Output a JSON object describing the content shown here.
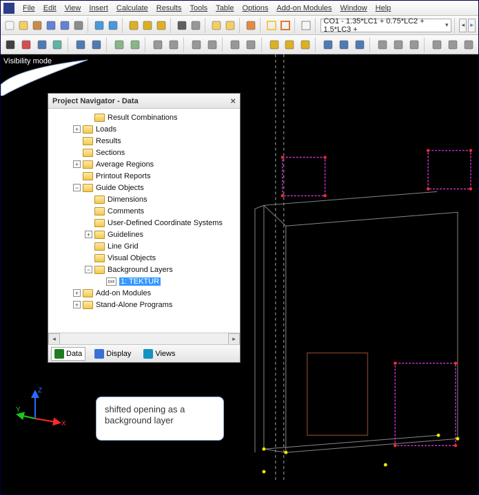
{
  "menu": {
    "items": [
      "File",
      "Edit",
      "View",
      "Insert",
      "Calculate",
      "Results",
      "Tools",
      "Table",
      "Options",
      "Add-on Modules",
      "Window",
      "Help"
    ]
  },
  "combo": {
    "value": "CO1 - 1.35*LC1 + 0.75*LC2 + 1.5*LC3 +"
  },
  "visibility_label": "Visibility mode",
  "panel": {
    "title": "Project Navigator - Data",
    "rows": [
      {
        "indent": 3,
        "exp": null,
        "icon": "fld",
        "label": "Result Combinations"
      },
      {
        "indent": 2,
        "exp": "+",
        "icon": "fld",
        "label": "Loads"
      },
      {
        "indent": 2,
        "exp": null,
        "icon": "fld",
        "label": "Results"
      },
      {
        "indent": 2,
        "exp": null,
        "icon": "fld",
        "label": "Sections"
      },
      {
        "indent": 2,
        "exp": "+",
        "icon": "fld",
        "label": "Average Regions"
      },
      {
        "indent": 2,
        "exp": null,
        "icon": "fld",
        "label": "Printout Reports"
      },
      {
        "indent": 2,
        "exp": "-",
        "icon": "fld",
        "label": "Guide Objects"
      },
      {
        "indent": 3,
        "exp": null,
        "icon": "fld",
        "label": "Dimensions"
      },
      {
        "indent": 3,
        "exp": null,
        "icon": "fld",
        "label": "Comments"
      },
      {
        "indent": 3,
        "exp": null,
        "icon": "fld",
        "label": "User-Defined Coordinate Systems"
      },
      {
        "indent": 3,
        "exp": "+",
        "icon": "fld",
        "label": "Guidelines"
      },
      {
        "indent": 3,
        "exp": null,
        "icon": "fld",
        "label": "Line Grid"
      },
      {
        "indent": 3,
        "exp": null,
        "icon": "fld",
        "label": "Visual Objects"
      },
      {
        "indent": 3,
        "exp": "-",
        "icon": "fld",
        "label": "Background Layers"
      },
      {
        "indent": 4,
        "exp": null,
        "icon": "dxf",
        "label": "1: TEKTUR",
        "selected": true
      },
      {
        "indent": 2,
        "exp": "+",
        "icon": "fld",
        "label": "Add-on Modules"
      },
      {
        "indent": 2,
        "exp": "+",
        "icon": "fld",
        "label": "Stand-Alone Programs"
      }
    ],
    "tabs": [
      {
        "label": "Data",
        "active": true,
        "icon": "#1e7e1e"
      },
      {
        "label": "Display",
        "active": false,
        "icon": "#3a6fd8"
      },
      {
        "label": "Views",
        "active": false,
        "icon": "#1393c2"
      }
    ]
  },
  "callout_text": "shifted opening as a background layer",
  "gizmo": {
    "x": "X",
    "y": "Y",
    "z": "Z"
  },
  "toolbar_icons_row1": [
    {
      "n": "new-icon",
      "c": "#f5f5f5"
    },
    {
      "n": "open-icon",
      "c": "#f3c84e"
    },
    {
      "n": "model-icon",
      "c": "#c07a2a"
    },
    {
      "n": "save-icon",
      "c": "#4a6fd0"
    },
    {
      "n": "save-all-icon",
      "c": "#4a6fd0"
    },
    {
      "n": "print-icon",
      "c": "#7a7a7a"
    },
    {
      "n": "sep"
    },
    {
      "n": "undo-icon",
      "c": "#2b88d8"
    },
    {
      "n": "redo-icon",
      "c": "#2b88d8"
    },
    {
      "n": "sep"
    },
    {
      "n": "calculate-icon",
      "c": "#d9a400"
    },
    {
      "n": "highlight-icon",
      "c": "#d9a400"
    },
    {
      "n": "dimension-icon",
      "c": "#d9a400"
    },
    {
      "n": "sep"
    },
    {
      "n": "snap-icon",
      "c": "#444"
    },
    {
      "n": "grid-icon",
      "c": "#888"
    },
    {
      "n": "sep"
    },
    {
      "n": "doc-a-icon",
      "c": "#f3c84e"
    },
    {
      "n": "doc-b-icon",
      "c": "#f3c84e"
    },
    {
      "n": "sep"
    },
    {
      "n": "results-icon",
      "c": "#e07828"
    },
    {
      "n": "sep"
    }
  ],
  "toolbar_icons_row2": [
    {
      "n": "cursor-icon",
      "c": "#222"
    },
    {
      "n": "node-icon",
      "c": "#c33"
    },
    {
      "n": "member-icon",
      "c": "#36a"
    },
    {
      "n": "surface-icon",
      "c": "#4a9"
    },
    {
      "n": "sep"
    },
    {
      "n": "load-node-icon",
      "c": "#36a"
    },
    {
      "n": "load-line-icon",
      "c": "#36a"
    },
    {
      "n": "sep"
    },
    {
      "n": "support-a-icon",
      "c": "#7a7"
    },
    {
      "n": "support-b-icon",
      "c": "#7a7"
    },
    {
      "n": "sep"
    },
    {
      "n": "copy-icon",
      "c": "#888"
    },
    {
      "n": "mirror-icon",
      "c": "#888"
    },
    {
      "n": "sep"
    },
    {
      "n": "rotate-icon",
      "c": "#888"
    },
    {
      "n": "scale-icon",
      "c": "#888"
    },
    {
      "n": "sep"
    },
    {
      "n": "mesh-icon",
      "c": "#888"
    },
    {
      "n": "refine-icon",
      "c": "#888"
    },
    {
      "n": "sep"
    },
    {
      "n": "filter-a-icon",
      "c": "#d9a400"
    },
    {
      "n": "filter-b-icon",
      "c": "#d9a400"
    },
    {
      "n": "filter-c-icon",
      "c": "#d9a400"
    },
    {
      "n": "sep"
    },
    {
      "n": "sel-a-icon",
      "c": "#36a"
    },
    {
      "n": "sel-b-icon",
      "c": "#36a"
    },
    {
      "n": "sel-c-icon",
      "c": "#36a"
    },
    {
      "n": "sep"
    },
    {
      "n": "view-iso-icon",
      "c": "#888"
    },
    {
      "n": "view-xy-icon",
      "c": "#888"
    },
    {
      "n": "view-xz-icon",
      "c": "#888"
    },
    {
      "n": "sep"
    },
    {
      "n": "win-a-icon",
      "c": "#888"
    },
    {
      "n": "win-b-icon",
      "c": "#888"
    },
    {
      "n": "win-c-icon",
      "c": "#888"
    }
  ]
}
